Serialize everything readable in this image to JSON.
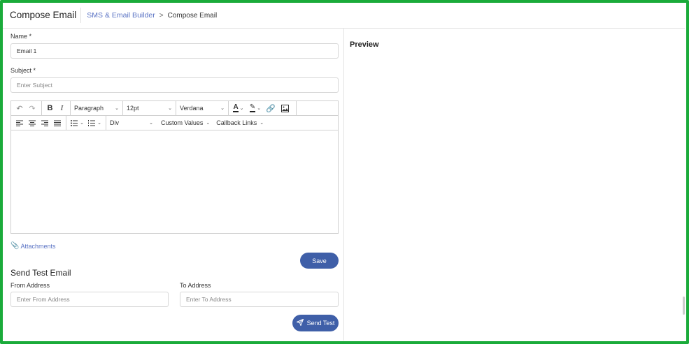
{
  "header": {
    "page_title": "Compose Email",
    "breadcrumb_link": "SMS & Email Builder",
    "breadcrumb_separator": ">",
    "breadcrumb_current": "Compose Email"
  },
  "form": {
    "name_label": "Name *",
    "name_value": "Email 1",
    "subject_label": "Subject *",
    "subject_placeholder": "Enter Subject"
  },
  "toolbar": {
    "block_format": "Paragraph",
    "font_size": "12pt",
    "font_family": "Verdana",
    "container": "Div",
    "custom_values": "Custom Values",
    "callback_links": "Callback Links"
  },
  "attachments_label": "Attachments",
  "save_label": "Save",
  "test_email": {
    "title": "Send Test Email",
    "from_label": "From Address",
    "from_placeholder": "Enter From Address",
    "to_label": "To Address",
    "to_placeholder": "Enter To Address",
    "send_label": "Send Test"
  },
  "preview": {
    "title": "Preview"
  },
  "colors": {
    "frame_border": "#1aab3a",
    "accent": "#3f5fa8",
    "link": "#5a73c4"
  }
}
